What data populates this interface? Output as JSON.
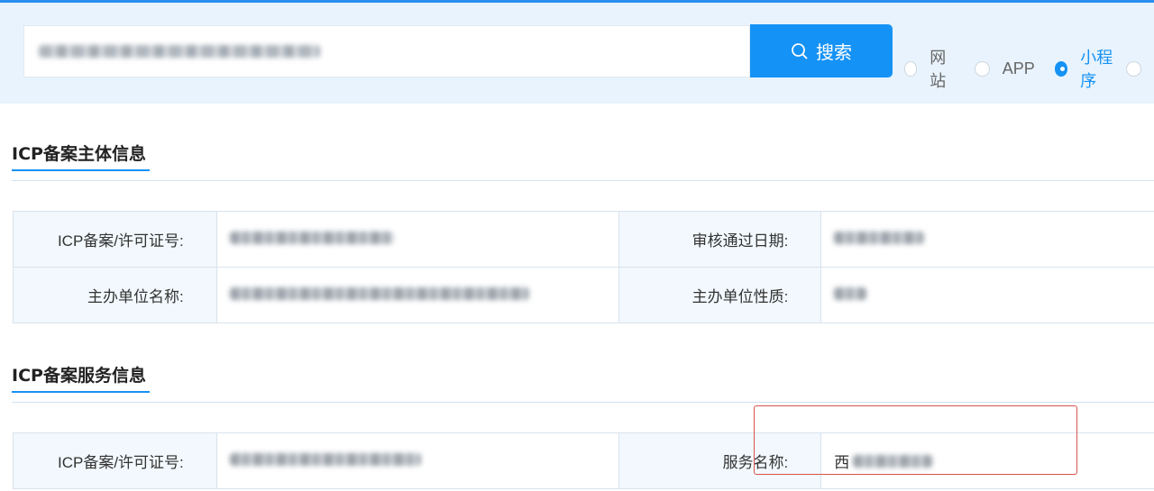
{
  "search": {
    "button_label": "搜索",
    "radio_options": [
      {
        "label": "网站",
        "checked": false
      },
      {
        "label": "APP",
        "checked": false
      },
      {
        "label": "小程序",
        "checked": true
      },
      {
        "label": "",
        "checked": false
      }
    ]
  },
  "subject_info": {
    "title": "ICP备案主体信息",
    "rows": [
      {
        "label1": "ICP备案/许可证号:",
        "label2": "审核通过日期:"
      },
      {
        "label1": "主办单位名称:",
        "label2": "主办单位性质:"
      }
    ]
  },
  "service_info": {
    "title": "ICP备案服务信息",
    "rows": [
      {
        "label1": "ICP备案/许可证号:",
        "label2": "服务名称:",
        "value2_prefix": "西"
      }
    ]
  },
  "colors": {
    "accent": "#1592f5",
    "search_bg": "#e8f3fd",
    "label_bg": "#f2f8fd",
    "highlight": "#d9534f"
  }
}
